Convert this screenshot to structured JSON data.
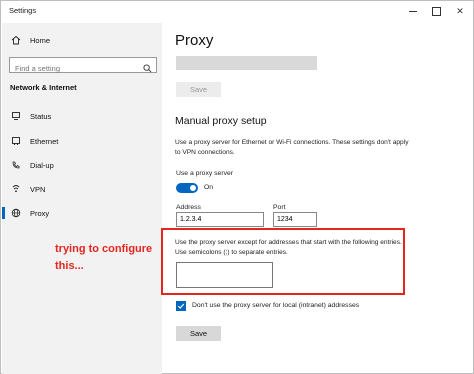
{
  "window": {
    "title": "Settings"
  },
  "sidebar": {
    "home_label": "Home",
    "search_placeholder": "Find a setting",
    "section_title": "Network & Internet",
    "items": [
      {
        "label": "Status",
        "icon": "status-icon"
      },
      {
        "label": "Ethernet",
        "icon": "ethernet-icon"
      },
      {
        "label": "Dial-up",
        "icon": "dialup-icon"
      },
      {
        "label": "VPN",
        "icon": "vpn-icon"
      },
      {
        "label": "Proxy",
        "icon": "globe-icon",
        "active": true
      }
    ]
  },
  "main": {
    "page_title": "Proxy",
    "top_save_label": "Save",
    "manual": {
      "heading": "Manual proxy setup",
      "description": "Use a proxy server for Ethernet or Wi-Fi connections. These settings don't apply to VPN connections.",
      "use_proxy_label": "Use a proxy server",
      "toggle_state": "On",
      "address_label": "Address",
      "address_value": "1.2.3.4",
      "port_label": "Port",
      "port_value": "1234",
      "exceptions_label": "Use the proxy server except for addresses that start with the following entries. Use semicolons (;) to separate entries.",
      "exceptions_value": "",
      "local_checkbox_label": "Don't use the proxy server for local (intranet) addresses",
      "save_label": "Save"
    }
  },
  "annotation": {
    "text": "trying to configure this...",
    "color": "#e3261f"
  },
  "colors": {
    "accent": "#0067c0",
    "annotation": "#e3261f"
  }
}
